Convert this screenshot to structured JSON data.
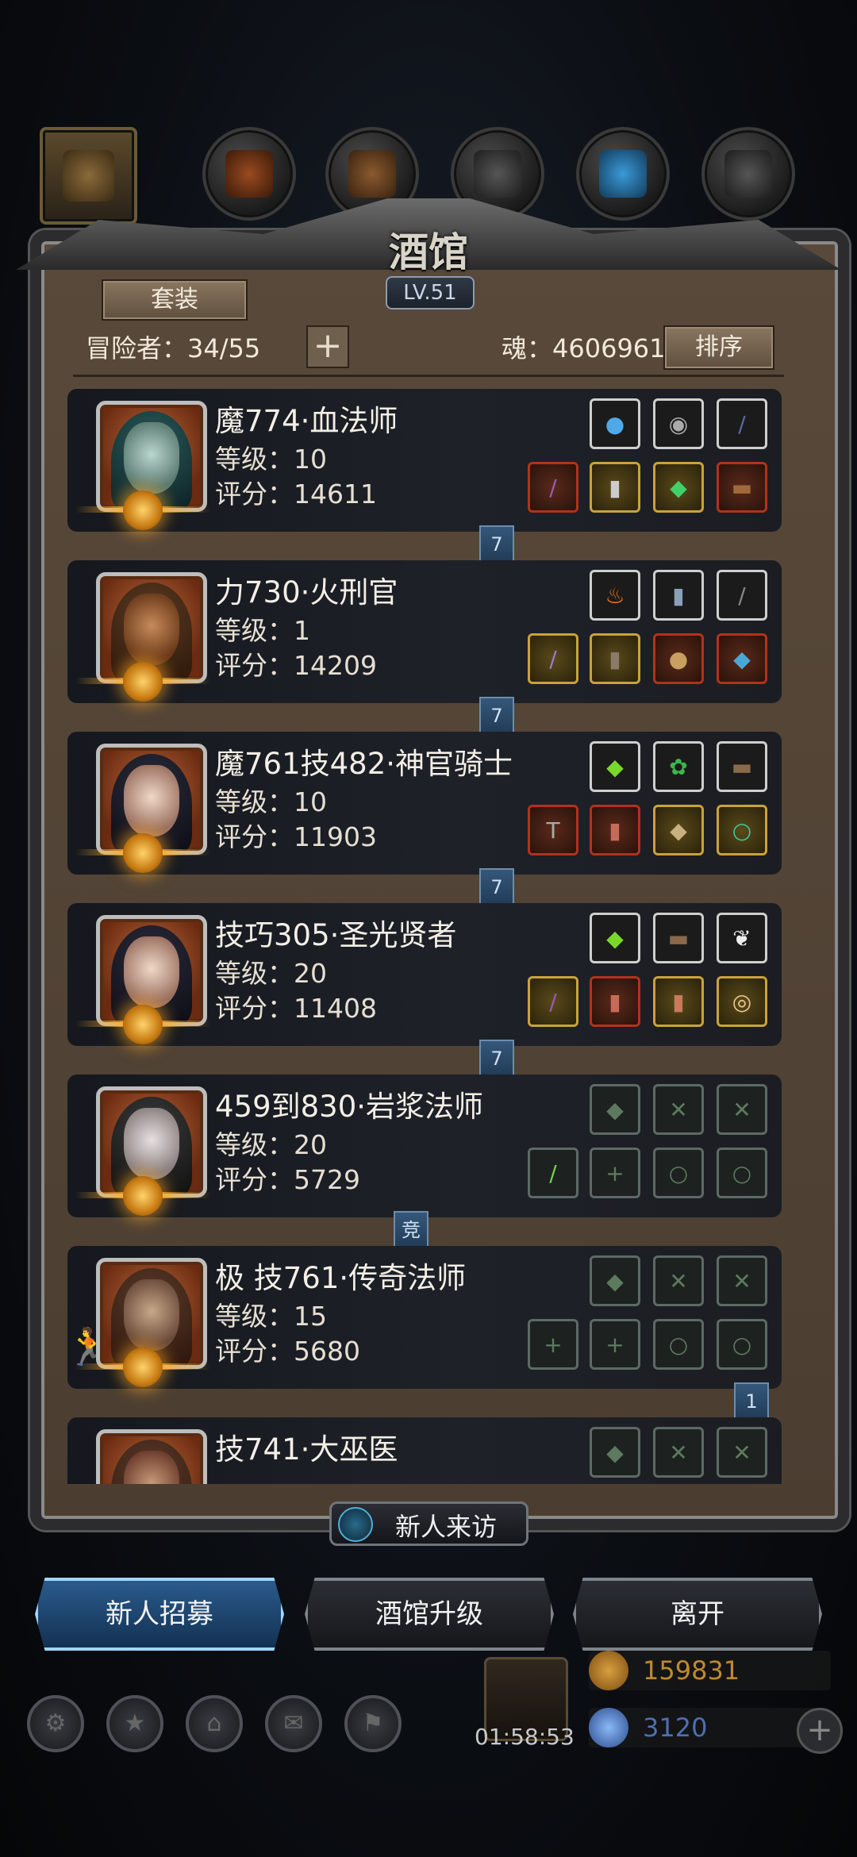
{
  "header": {
    "title": "酒馆",
    "level": "LV.51",
    "set_button": "套装",
    "adventurers_label": "冒险者：34/55",
    "add_icon": "plus-icon",
    "soul_label": "魂：4606961",
    "sort_button": "排序"
  },
  "categories": [
    "category-all",
    "category-leather",
    "category-wood",
    "category-iron",
    "category-crystal",
    "category-steel"
  ],
  "heroes": [
    {
      "name": "魔774·血法师",
      "level": "等级：10",
      "score": "评分：14611",
      "badge": "7",
      "top_slots": [
        "orb",
        "mask",
        "rune"
      ],
      "bottom_slots": [
        "staff",
        "armor",
        "gem",
        "book"
      ]
    },
    {
      "name": "力730·火刑官",
      "level": "等级：1",
      "score": "评分：14209",
      "badge": "7",
      "top_slots": [
        "fire",
        "scroll",
        "feather"
      ],
      "bottom_slots": [
        "mace",
        "armor",
        "shield",
        "gauntlet"
      ]
    },
    {
      "name": "魔761技482·神官骑士",
      "level": "等级：10",
      "score": "评分：11903",
      "badge": "7",
      "top_slots": [
        "potion",
        "herb",
        "bracer"
      ],
      "bottom_slots": [
        "hammer",
        "armor",
        "shield",
        "amulet"
      ]
    },
    {
      "name": "技巧305·圣光贤者",
      "level": "等级：20",
      "score": "评分：11408",
      "badge": "7",
      "top_slots": [
        "potion",
        "bracer",
        "wing"
      ],
      "bottom_slots": [
        "staff",
        "armor",
        "cloak",
        "clock"
      ]
    },
    {
      "name": "459到830·岩浆法师",
      "level": "等级：20",
      "score": "评分：5729",
      "badge": "竞",
      "top_slots": [
        "empty",
        "empty",
        "empty"
      ],
      "bottom_slots": [
        "staff",
        "empty",
        "empty",
        "empty"
      ]
    },
    {
      "name": "极 技761·传奇法师",
      "level": "等级：15",
      "score": "评分：5680",
      "badge": "1",
      "top_slots": [
        "empty",
        "empty",
        "empty"
      ],
      "bottom_slots": [
        "empty",
        "empty",
        "empty",
        "empty"
      ]
    },
    {
      "name": "技741·大巫医",
      "level": "",
      "score": "",
      "badge": "",
      "top_slots": [
        "empty",
        "empty",
        "empty"
      ],
      "bottom_slots": []
    }
  ],
  "bottom": {
    "new_visitor": "新人来访",
    "recruit": "新人招募",
    "upgrade": "酒馆升级",
    "leave": "离开",
    "timer": "01:58:53",
    "gold": "159831",
    "gems": "3120"
  },
  "colors": {
    "accent_blue": "#5ec6ff",
    "gold": "#c08a2c",
    "gem": "#4c6fb0"
  }
}
